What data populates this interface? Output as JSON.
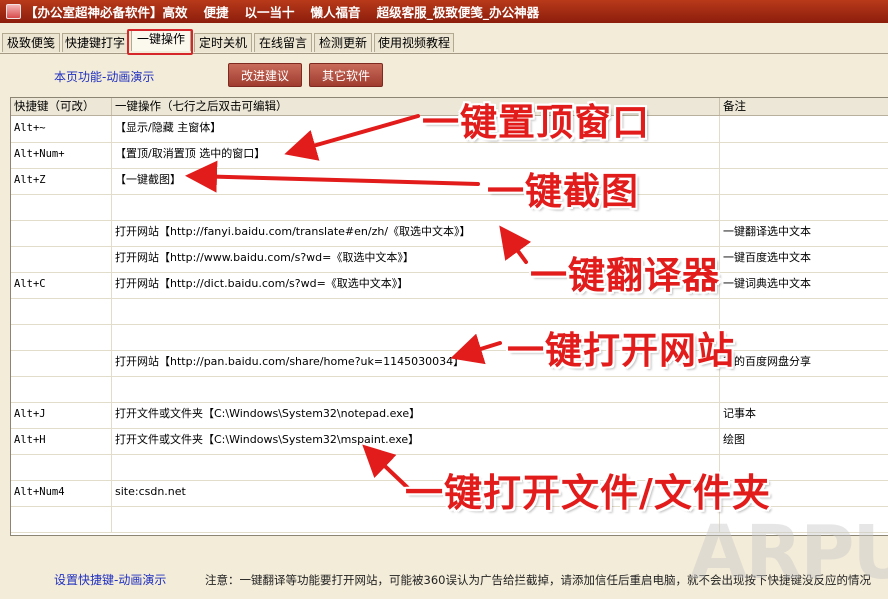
{
  "titlebar": {
    "items": [
      "【办公室超神必备软件】高效",
      "便捷",
      "以一当十",
      "懒人福音",
      "超级客服_极致便笺_办公神器"
    ]
  },
  "tabs": [
    "极致便笺",
    "快捷键打字",
    "一键操作",
    "定时关机",
    "在线留言",
    "检测更新",
    "使用视频教程"
  ],
  "active_tab": "一键操作",
  "page_function_link": "本页功能-动画演示",
  "buttons": {
    "improve": "改进建议",
    "other": "其它软件"
  },
  "grid": {
    "headers": [
      "快捷键（可改）",
      "一键操作（七行之后双击可编辑）",
      "备注"
    ],
    "rows": [
      {
        "key": "Alt+~",
        "action": "【显示/隐藏 主窗体】",
        "note": ""
      },
      {
        "key": "Alt+Num+",
        "action": "【置顶/取消置顶 选中的窗口】",
        "note": ""
      },
      {
        "key": "Alt+Z",
        "action": "【一键截图】",
        "note": ""
      },
      {
        "key": "",
        "action": "",
        "note": ""
      },
      {
        "key": "",
        "action": "打开网站【http://fanyi.baidu.com/translate#en/zh/《取选中文本》】",
        "note": "一键翻译选中文本"
      },
      {
        "key": "",
        "action": "打开网站【http://www.baidu.com/s?wd=《取选中文本》】",
        "note": "一键百度选中文本"
      },
      {
        "key": "Alt+C",
        "action": "打开网站【http://dict.baidu.com/s?wd=《取选中文本》】",
        "note": "一键词典选中文本"
      },
      {
        "key": "",
        "action": "",
        "note": ""
      },
      {
        "key": "",
        "action": "",
        "note": ""
      },
      {
        "key": "",
        "action": "打开网站【http://pan.baidu.com/share/home?uk=1145030034】",
        "note": "我的百度网盘分享"
      },
      {
        "key": "",
        "action": "",
        "note": ""
      },
      {
        "key": "Alt+J",
        "action": "打开文件或文件夹【C:\\Windows\\System32\\notepad.exe】",
        "note": "记事本"
      },
      {
        "key": "Alt+H",
        "action": "打开文件或文件夹【C:\\Windows\\System32\\mspaint.exe】",
        "note": "绘图"
      },
      {
        "key": "",
        "action": "",
        "note": ""
      },
      {
        "key": "Alt+Num4",
        "action": " site:csdn.net",
        "note": ""
      },
      {
        "key": "",
        "action": "",
        "note": ""
      }
    ]
  },
  "footer": {
    "link": "设置快捷键-动画演示",
    "note": "注意：一键翻译等功能要打开网站，可能被360误认为广告给拦截掉，请添加信任后重启电脑，就不会出现按下快捷键没反应的情况"
  },
  "annotations": {
    "a1": "一键置顶窗口",
    "a2": "一键截图",
    "a3": "一键翻译器",
    "a4": "一键打开网站",
    "a5": "一键打开文件/文件夹"
  },
  "watermark": "ARPUN",
  "colors": {
    "titlebar": "#a52a14",
    "button": "#b0503f",
    "highlight": "#d6262a",
    "annotation": "#e21b1b",
    "link": "#2030c0"
  }
}
